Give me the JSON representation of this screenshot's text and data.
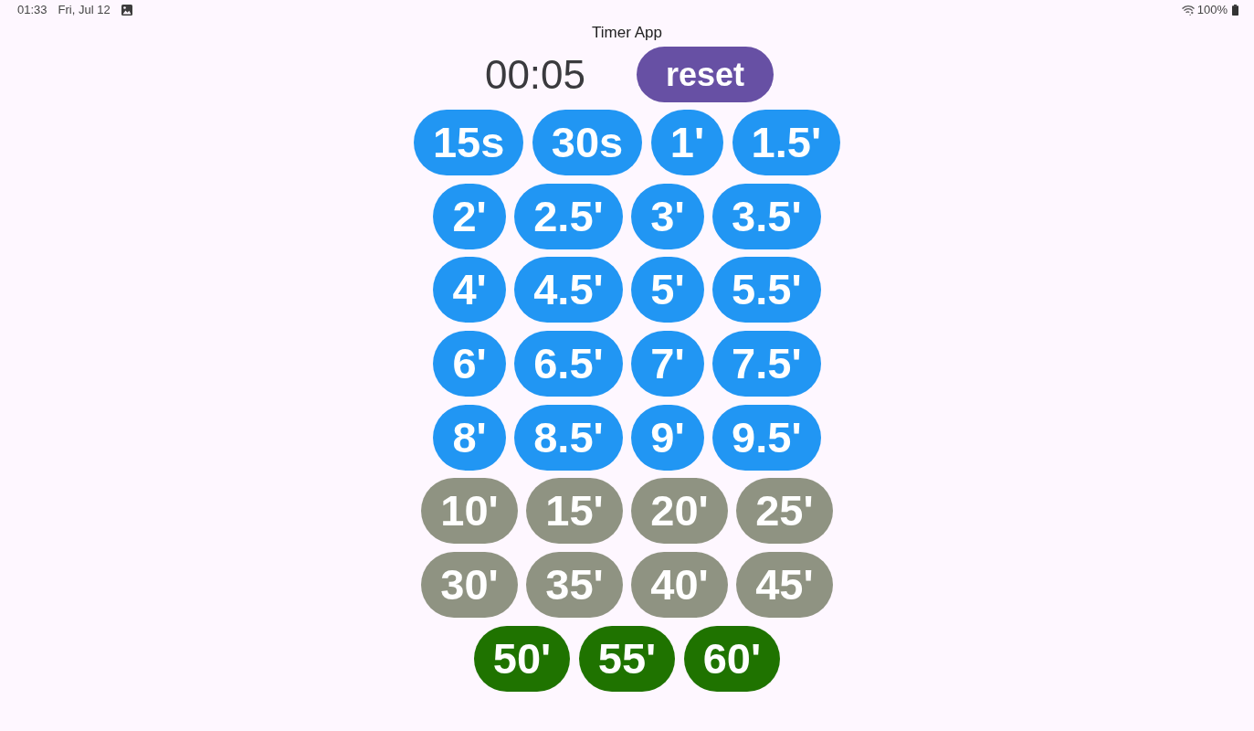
{
  "status_bar": {
    "time": "01:33",
    "date": "Fri, Jul 12",
    "battery": "100%"
  },
  "app_bar": {
    "title": "Timer App"
  },
  "timer": {
    "display": "00:05",
    "reset_button": "reset"
  },
  "preset_rows": [
    {
      "buttons": [
        {
          "label": "15s",
          "color": "#2196f3"
        },
        {
          "label": "30s",
          "color": "#2196f3"
        },
        {
          "label": "1'",
          "color": "#2196f3"
        },
        {
          "label": "1.5'",
          "color": "#2196f3"
        }
      ]
    },
    {
      "buttons": [
        {
          "label": "2'",
          "color": "#2196f3"
        },
        {
          "label": "2.5'",
          "color": "#2196f3"
        },
        {
          "label": "3'",
          "color": "#2196f3"
        },
        {
          "label": "3.5'",
          "color": "#2196f3"
        }
      ]
    },
    {
      "buttons": [
        {
          "label": "4'",
          "color": "#2196f3"
        },
        {
          "label": "4.5'",
          "color": "#2196f3"
        },
        {
          "label": "5'",
          "color": "#2196f3"
        },
        {
          "label": "5.5'",
          "color": "#2196f3"
        }
      ]
    },
    {
      "buttons": [
        {
          "label": "6'",
          "color": "#2196f3"
        },
        {
          "label": "6.5'",
          "color": "#2196f3"
        },
        {
          "label": "7'",
          "color": "#2196f3"
        },
        {
          "label": "7.5'",
          "color": "#2196f3"
        }
      ]
    },
    {
      "buttons": [
        {
          "label": "8'",
          "color": "#2196f3"
        },
        {
          "label": "8.5'",
          "color": "#2196f3"
        },
        {
          "label": "9'",
          "color": "#2196f3"
        },
        {
          "label": "9.5'",
          "color": "#2196f3"
        }
      ]
    },
    {
      "buttons": [
        {
          "label": "10'",
          "color": "#8f9382"
        },
        {
          "label": "15'",
          "color": "#8f9382"
        },
        {
          "label": "20'",
          "color": "#8f9382"
        },
        {
          "label": "25'",
          "color": "#8f9382"
        }
      ]
    },
    {
      "buttons": [
        {
          "label": "30'",
          "color": "#8f9382"
        },
        {
          "label": "35'",
          "color": "#8f9382"
        },
        {
          "label": "40'",
          "color": "#8f9382"
        },
        {
          "label": "45'",
          "color": "#8f9382"
        }
      ]
    },
    {
      "buttons": [
        {
          "label": "50'",
          "color": "#1f7300"
        },
        {
          "label": "55'",
          "color": "#1f7300"
        },
        {
          "label": "60'",
          "color": "#1f7300"
        }
      ]
    }
  ]
}
